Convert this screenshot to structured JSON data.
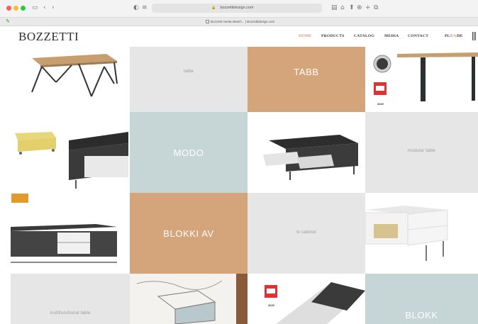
{
  "browser": {
    "url": "bozzettidesign.com",
    "tab_title": "Bozzetti mesta sketch... | Bozzettidesign.com"
  },
  "header": {
    "logo": "BOZZETTI",
    "nav": [
      "HOME",
      "PRODUCTS",
      "CATALOG",
      "MEDIA",
      "CONTACT"
    ],
    "lang": {
      "pl": "PL",
      "en": "EN",
      "de": "DE",
      "sep": "/"
    }
  },
  "tiles": {
    "table": "table",
    "tabb": "TABB",
    "modo": "MODO",
    "modular_table": "modular table",
    "blokki_av": "BLOKKI AV",
    "tv_cabinet": "tv cabinet",
    "multifunctional_table": "multifunctional table",
    "blokk": "BLOKK",
    "award_1": "2020",
    "award_2": "2020"
  },
  "colors": {
    "accent": "#c99a6e",
    "tan": "#d4a47a",
    "blue": "#c6d5d5",
    "grey": "#e6e6e6",
    "orange": "#e39a2d"
  }
}
